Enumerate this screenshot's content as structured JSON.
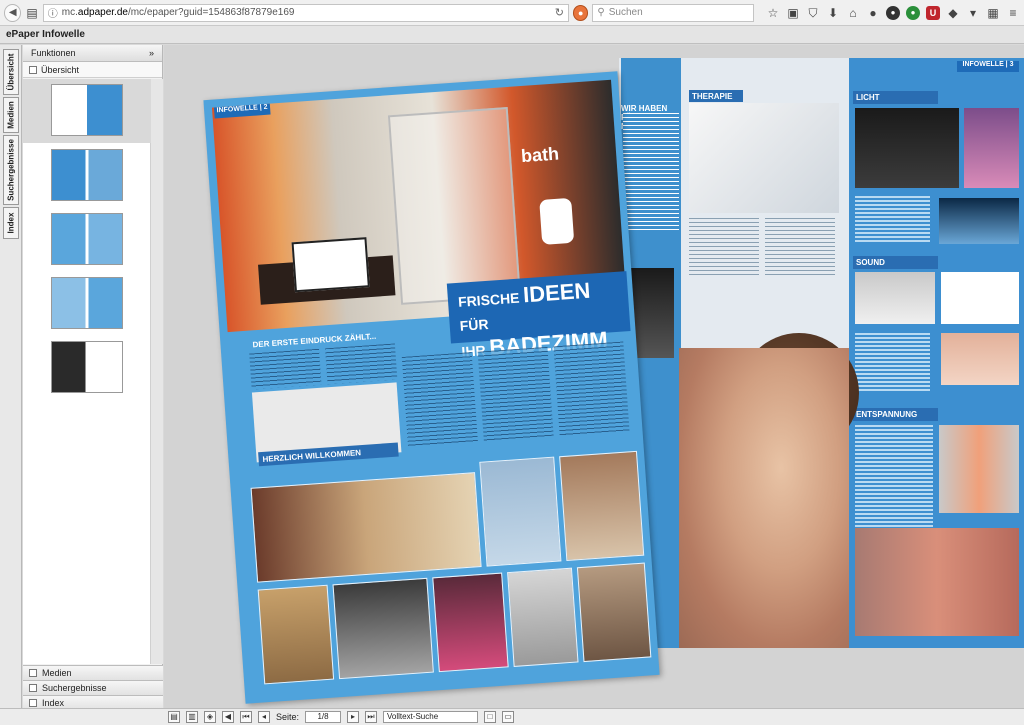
{
  "browser": {
    "url_prefix": "mc.",
    "url_host": "adpaper.de",
    "url_path": "/mc/epaper?guid=154863f87879e169",
    "search_placeholder": "Suchen"
  },
  "app": {
    "title": "ePaper Infowelle"
  },
  "vertical_tabs": [
    "Übersicht",
    "Medien",
    "Suchergebnisse",
    "Index"
  ],
  "sidebar": {
    "functions_label": "Funktionen",
    "functions_toggle": "»",
    "overview_label": "Übersicht",
    "bottom_panels": [
      "Medien",
      "Suchergebnisse",
      "Index"
    ]
  },
  "magazine": {
    "left_tag": "INFOWELLE | 2",
    "bath_word": "bath",
    "headline_line1_a": "FRISCHE ",
    "headline_line1_b": "IDEEN",
    "headline_line1_c": " FÜR",
    "headline_line2_a": "IHR ",
    "headline_line2_b": "BADEZIMM",
    "first_impression": "DER ERSTE EINDRUCK ZÄHLT...",
    "welcome": "HERZLICH WILLKOMMEN",
    "mid_headline": "WIR HABEN FÜR SIE DIE NEUHEITEN",
    "therapie": "THERAPIE",
    "right_tag": "INFOWELLE | 3",
    "licht": "LICHT",
    "sound": "SOUND",
    "entspannung": "ENTSPANNUNG"
  },
  "viewer_bar": {
    "page_label": "Seite:",
    "page_value": "1/8",
    "fulltext_placeholder": "Volltext-Suche"
  }
}
